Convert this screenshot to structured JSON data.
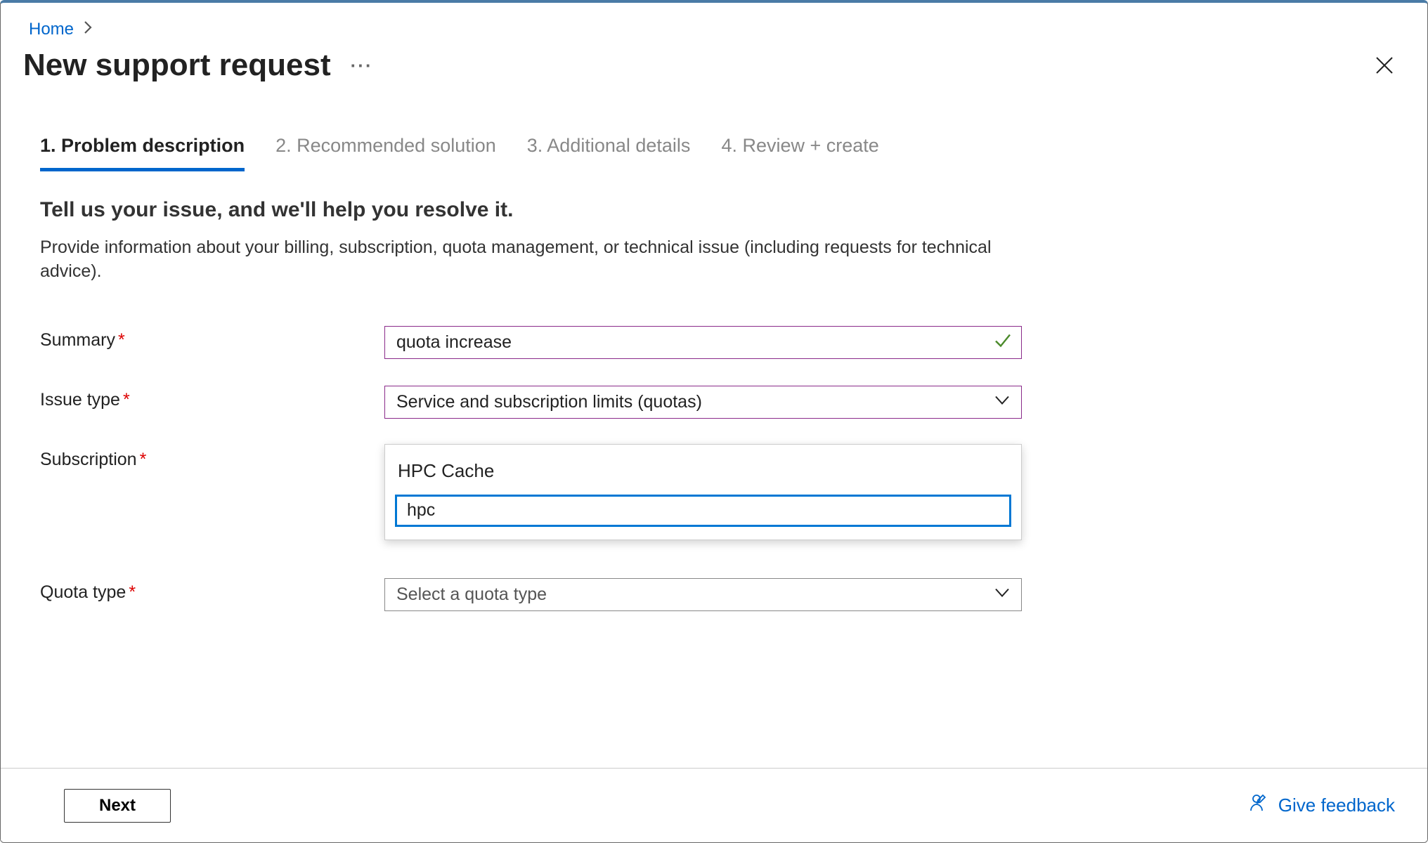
{
  "breadcrumb": {
    "home": "Home"
  },
  "page_title": "New support request",
  "tabs": [
    {
      "label": "1. Problem description",
      "active": true
    },
    {
      "label": "2. Recommended solution",
      "active": false
    },
    {
      "label": "3. Additional details",
      "active": false
    },
    {
      "label": "4. Review + create",
      "active": false
    }
  ],
  "section": {
    "heading": "Tell us your issue, and we'll help you resolve it.",
    "description": "Provide information about your billing, subscription, quota management, or technical issue (including requests for technical advice)."
  },
  "form": {
    "summary": {
      "label": "Summary",
      "value": "quota increase",
      "required": true
    },
    "issue_type": {
      "label": "Issue type",
      "value": "Service and subscription limits (quotas)",
      "required": true
    },
    "subscription": {
      "label": "Subscription",
      "required": true,
      "popup_option": "HPC Cache",
      "filter_value": "hpc"
    },
    "quota_type": {
      "label": "Quota type",
      "placeholder": "Select a quota type",
      "required": true
    }
  },
  "footer": {
    "next": "Next",
    "feedback": "Give feedback"
  }
}
